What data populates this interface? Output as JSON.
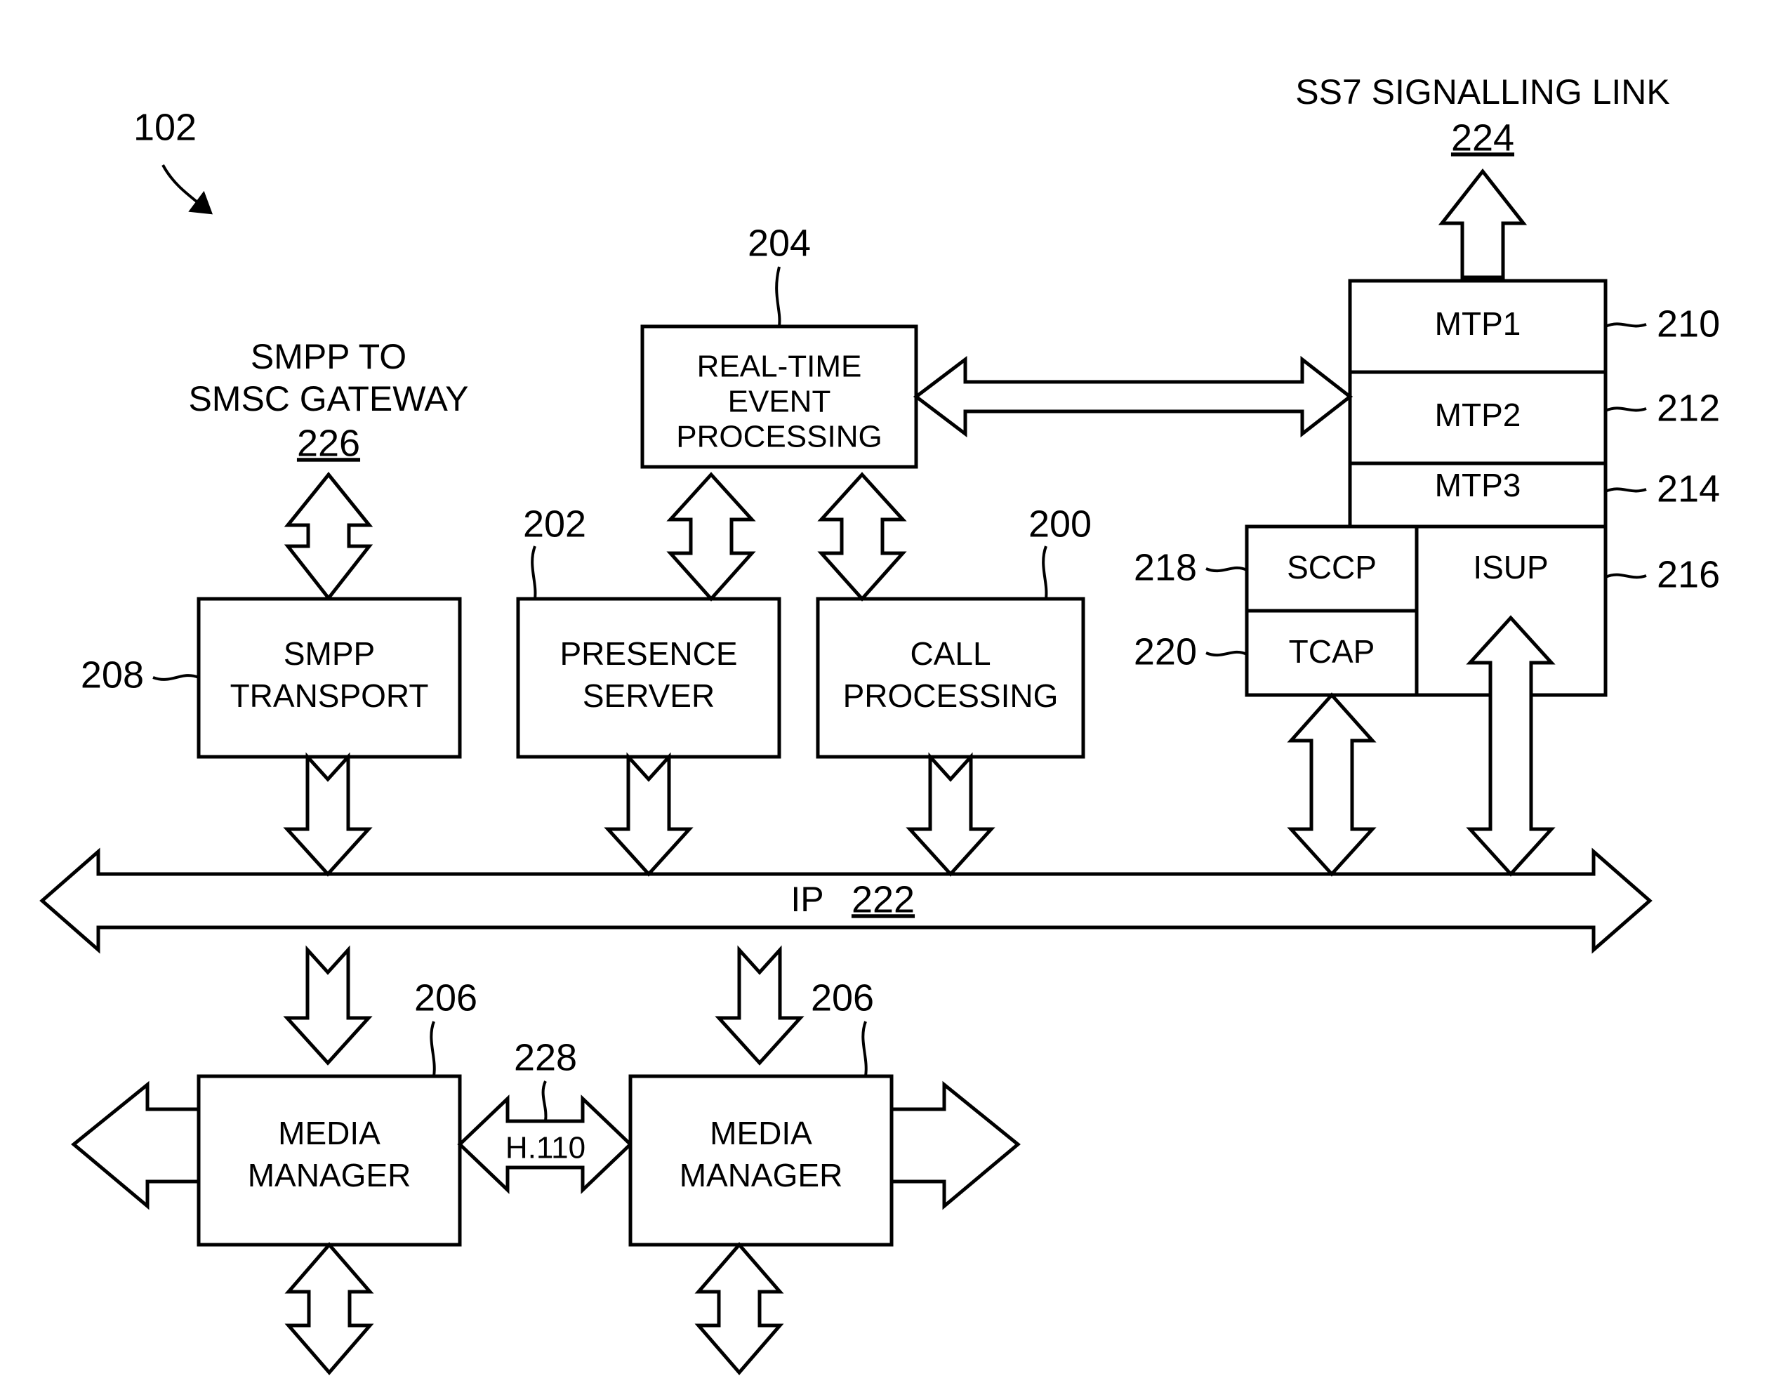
{
  "figure": {
    "figure_ref": "102",
    "top_caption": {
      "line1": "SS7 SIGNALLING LINK",
      "ref": "224"
    },
    "gateway_caption": {
      "line1": "SMPP TO",
      "line2": "SMSC GATEWAY",
      "ref": "226"
    },
    "bus": {
      "label": "IP",
      "ref": "222"
    },
    "h110": {
      "label": "H.110",
      "ref": "228"
    },
    "boxes": {
      "real_time_event_processing": {
        "line1": "REAL-TIME",
        "line2": "EVENT",
        "line3": "PROCESSING",
        "ref": "204"
      },
      "smpp_transport": {
        "line1": "SMPP",
        "line2": "TRANSPORT",
        "ref": "208"
      },
      "presence_server": {
        "line1": "PRESENCE",
        "line2": "SERVER",
        "ref": "202"
      },
      "call_processing": {
        "line1": "CALL",
        "line2": "PROCESSING",
        "ref": "200"
      },
      "media_manager_left": {
        "line1": "MEDIA",
        "line2": "MANAGER",
        "ref": "206"
      },
      "media_manager_right": {
        "line1": "MEDIA",
        "line2": "MANAGER",
        "ref": "206"
      },
      "mtp1": {
        "label": "MTP1",
        "ref": "210"
      },
      "mtp2": {
        "label": "MTP2",
        "ref": "212"
      },
      "mtp3": {
        "label": "MTP3",
        "ref": "214"
      },
      "sccp": {
        "label": "SCCP",
        "ref": "218"
      },
      "tcap": {
        "label": "TCAP",
        "ref": "220"
      },
      "isup": {
        "label": "ISUP",
        "ref": "216"
      }
    },
    "colors": {
      "stroke": "#000000",
      "fill": "#ffffff"
    }
  }
}
